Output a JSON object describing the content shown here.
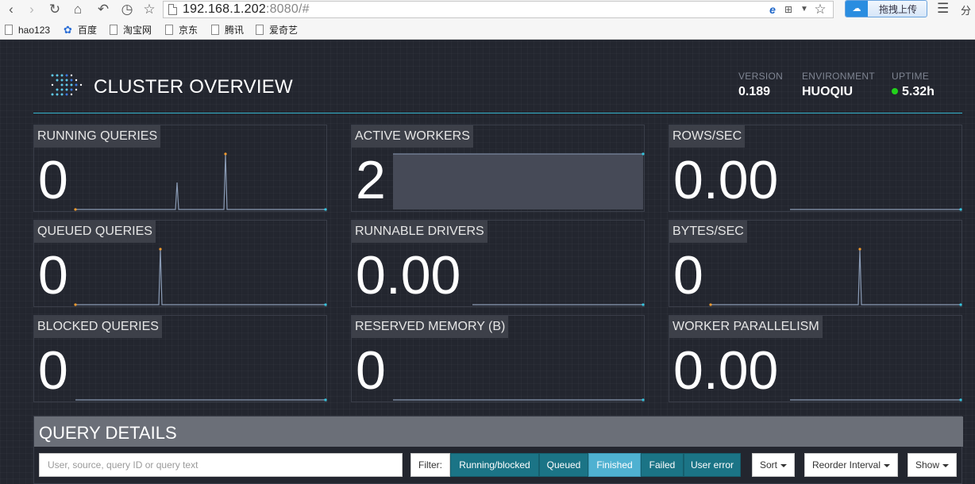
{
  "browser": {
    "nav": {
      "back": "‹",
      "forward": "›",
      "reload": "↻",
      "home": "⌂",
      "undo": "↶",
      "history": "◷",
      "favorite": "☆"
    },
    "url_host": "192.168.1.202",
    "url_rest": ":8080/#",
    "upload_label": "拖拽上传",
    "cut_label": "分",
    "bookmarks": [
      "hao123",
      "百度",
      "淘宝网",
      "京东",
      "腾讯",
      "爱奇艺"
    ]
  },
  "header": {
    "title": "CLUSTER OVERVIEW",
    "version_label": "VERSION",
    "version": "0.189",
    "environment_label": "ENVIRONMENT",
    "environment": "HUOQIU",
    "uptime_label": "UPTIME",
    "uptime": "5.32h"
  },
  "tiles": [
    {
      "label": "RUNNING QUERIES",
      "value": "0"
    },
    {
      "label": "ACTIVE WORKERS",
      "value": "2"
    },
    {
      "label": "ROWS/SEC",
      "value": "0.00"
    },
    {
      "label": "QUEUED QUERIES",
      "value": "0"
    },
    {
      "label": "RUNNABLE DRIVERS",
      "value": "0.00"
    },
    {
      "label": "BYTES/SEC",
      "value": "0"
    },
    {
      "label": "BLOCKED QUERIES",
      "value": "0"
    },
    {
      "label": "RESERVED MEMORY (B)",
      "value": "0"
    },
    {
      "label": "WORKER PARALLELISM",
      "value": "0.00"
    }
  ],
  "query_details": {
    "title": "QUERY DETAILS",
    "search_placeholder": "User, source, query ID or query text",
    "filter_label": "Filter:",
    "filters": [
      "Running/blocked",
      "Queued",
      "Finished",
      "Failed",
      "User error"
    ],
    "active_filter": "Finished",
    "sort_label": "Sort",
    "reorder_label": "Reorder Interval",
    "show_label": "Show"
  },
  "colors": {
    "accent": "#35b4cc",
    "spark_start": "#f29b2e",
    "spark_end": "#35c6e0",
    "uptime_dot": "#22d11b"
  }
}
